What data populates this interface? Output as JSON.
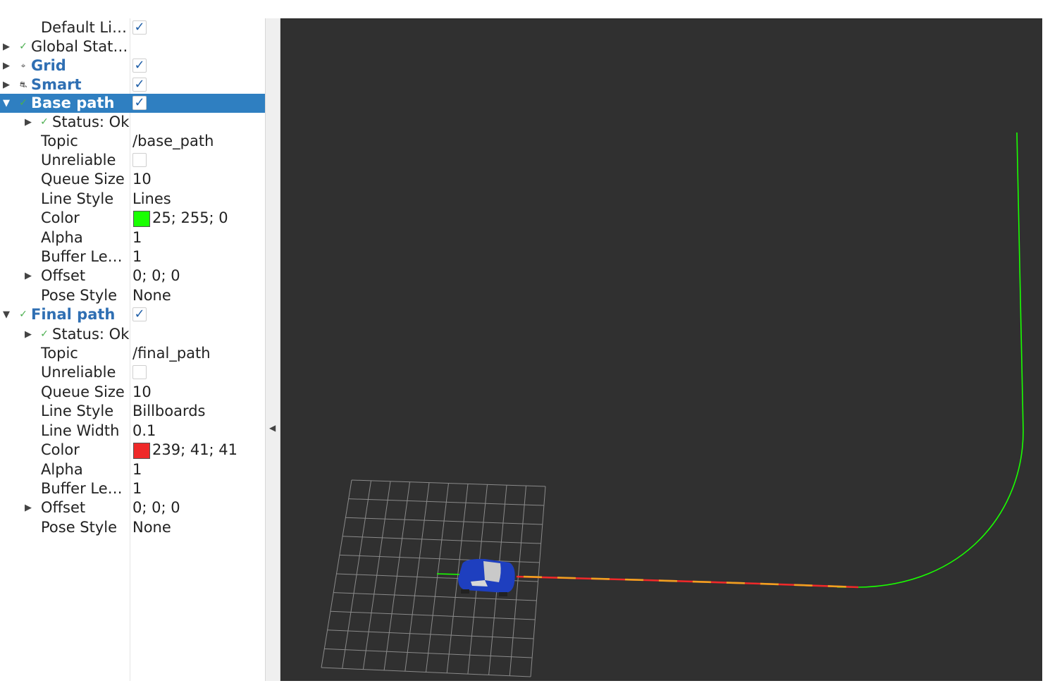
{
  "displays": {
    "default_light": {
      "label": "Default Li…",
      "checked": "✓"
    },
    "global_status": {
      "label": "Global Stat…",
      "expander": "▶",
      "icon": "✓"
    },
    "grid": {
      "label": "Grid",
      "expander": "▶",
      "icon": "⌖",
      "checked": "✓"
    },
    "smart": {
      "label": "Smart",
      "expander": "▶",
      "icon": "⛐",
      "checked": "✓"
    },
    "base_path": {
      "label": "Base path",
      "expander": "▼",
      "icon": "✓",
      "checked": "✓",
      "status": {
        "label": "Status: Ok",
        "expander": "▶",
        "icon": "✓"
      },
      "props": [
        {
          "name": "Topic",
          "value": "/base_path"
        },
        {
          "name": "Unreliable",
          "value": ""
        },
        {
          "name": "Queue Size",
          "value": "10"
        },
        {
          "name": "Line Style",
          "value": "Lines"
        },
        {
          "name": "Color",
          "value": "25; 255; 0",
          "color": "#19ff00"
        },
        {
          "name": "Alpha",
          "value": "1"
        },
        {
          "name": "Buffer Le…",
          "value": "1"
        },
        {
          "name": "Offset",
          "value": "0; 0; 0",
          "expander": "▶"
        },
        {
          "name": "Pose Style",
          "value": "None"
        }
      ]
    },
    "final_path": {
      "label": "Final path",
      "expander": "▼",
      "icon": "✓",
      "checked": "✓",
      "status": {
        "label": "Status: Ok",
        "expander": "▶",
        "icon": "✓"
      },
      "props": [
        {
          "name": "Topic",
          "value": "/final_path"
        },
        {
          "name": "Unreliable",
          "value": ""
        },
        {
          "name": "Queue Size",
          "value": "10"
        },
        {
          "name": "Line Style",
          "value": "Billboards"
        },
        {
          "name": "Line Width",
          "value": "0.1"
        },
        {
          "name": "Color",
          "value": "239; 41; 41",
          "color": "#ef2929"
        },
        {
          "name": "Alpha",
          "value": "1"
        },
        {
          "name": "Buffer Le…",
          "value": "1"
        },
        {
          "name": "Offset",
          "value": "0; 0; 0",
          "expander": "▶"
        },
        {
          "name": "Pose Style",
          "value": "None"
        }
      ]
    }
  },
  "splitter": {
    "arrow": "◀"
  },
  "scene": {
    "background_color": "#303030",
    "grid_color": "#8a8a8a",
    "base_path_color": "#19ff00",
    "final_path_color": "#ef2929",
    "car_color": "#1e3fbf"
  }
}
